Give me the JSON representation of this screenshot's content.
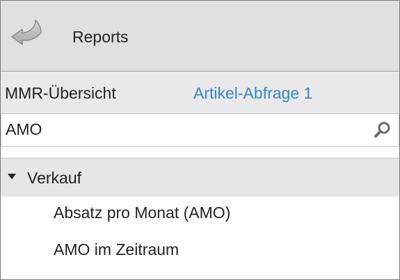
{
  "header": {
    "back_icon": "back-arrow-icon",
    "title": "Reports"
  },
  "tabs": [
    {
      "label": "MMR-Übersicht",
      "active": false
    },
    {
      "label": "Artikel-Abfrage 1",
      "active": true,
      "color": "#3a86c8"
    }
  ],
  "search": {
    "value": "AMO",
    "placeholder": "",
    "icon": "search-icon"
  },
  "tree": {
    "group": {
      "label": "Verkauf",
      "expanded": true,
      "caret_icon": "caret-down-icon"
    },
    "items": [
      {
        "label": "Absatz pro Monat (AMO)"
      },
      {
        "label": "AMO im Zeitraum"
      }
    ]
  },
  "colors": {
    "header_bg": "#e0e0e0",
    "tabs_bg": "#e9e9e9",
    "group_bg": "#e6e6e6",
    "link_blue": "#3a86c8",
    "text": "#222222"
  }
}
